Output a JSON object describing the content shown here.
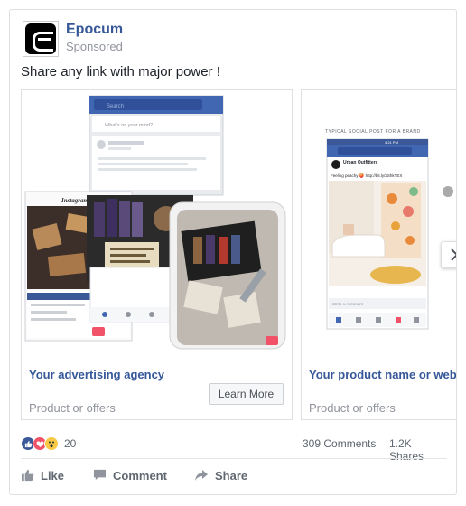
{
  "post": {
    "page_name": "Epocum",
    "sponsored_label": "Sponsored",
    "text": "Share any link with major power !"
  },
  "carousel": {
    "slides": [
      {
        "title": "Your advertising agency",
        "subtitle": "Product or offers",
        "button_label": "Learn More"
      },
      {
        "title": "Your product name or website",
        "subtitle": "Product or offers"
      }
    ]
  },
  "mockups": {
    "facebook_search": "Search",
    "whats_on_mind": "What's on your mind?",
    "instagram_logo": "Instagram",
    "status_time": "4:21 PM",
    "typical_post_caption": "TYPICAL SOCIAL POST FOR A BRAND",
    "brand_name": "Urban Outfitters",
    "brand_post_text": "Feeling peachy 🍑 http://bit.ly/2ShkTEX",
    "write_comment": "Write a comment..."
  },
  "stats": {
    "reaction_count": "20",
    "comments": "309 Comments",
    "shares": "1.2K Shares"
  },
  "actions": {
    "like": "Like",
    "comment": "Comment",
    "share": "Share"
  },
  "colors": {
    "brand_blue": "#365899",
    "fb_blue": "#3b5998",
    "muted": "#90949c"
  }
}
